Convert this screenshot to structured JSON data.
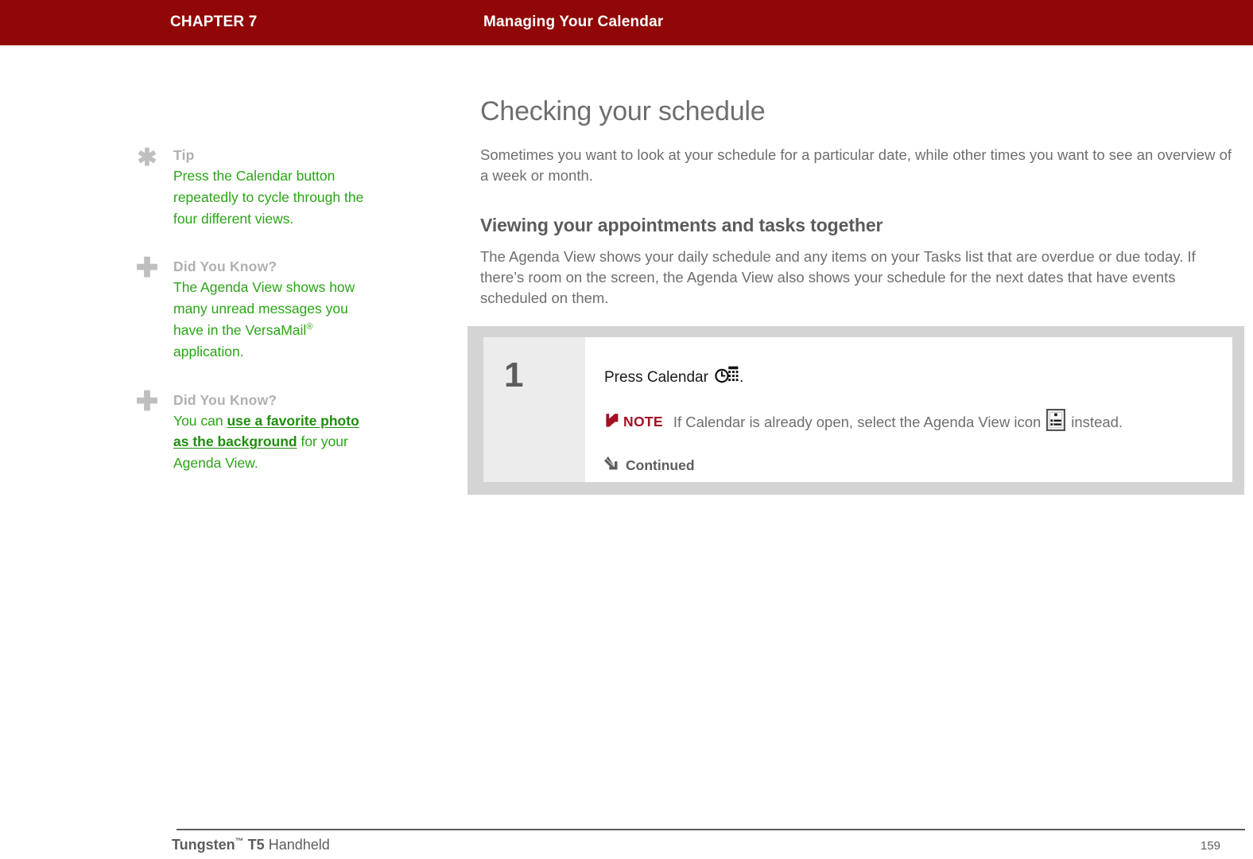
{
  "header": {
    "chapter": "CHAPTER 7",
    "title": "Managing Your Calendar",
    "bar_color": "#910606"
  },
  "sidebar": {
    "items": [
      {
        "icon": "asterisk-icon",
        "label": "Tip",
        "body": "Press the Calendar button repeatedly to cycle through the four different views."
      },
      {
        "icon": "plus-icon",
        "label": "Did You Know?",
        "body_before": "The Agenda View shows how many unread messages you have in the VersaMail",
        "superscript": "®",
        "body_after": " application."
      },
      {
        "icon": "plus-icon",
        "label": "Did You Know?",
        "body_before": "You can ",
        "link": "use a favorite photo as the background",
        "body_after": " for your Agenda View."
      }
    ],
    "label_color": "#b0b0b0",
    "body_color": "#2aa515"
  },
  "main": {
    "page_title": "Checking your schedule",
    "intro": "Sometimes you want to look at your schedule for a particular date, while other times you want to see an overview of a week or month.",
    "section_title": "Viewing your appointments and tasks together",
    "section_body": "The Agenda View shows your daily schedule and any items on your Tasks list that are overdue or due today. If there’s room on the screen, the Agenda View also shows your schedule for the next dates that have events scheduled on them."
  },
  "step_box": {
    "number": "1",
    "instruction": "Press Calendar",
    "instruction_end": ".",
    "calendar_icon": "calendar-icon",
    "note_label": "NOTE",
    "note_icon": "note-flag-icon",
    "note_text_before": "If Calendar is already open, select the Agenda View icon",
    "agenda_icon": "agenda-view-icon",
    "note_text_after": "instead.",
    "continued_label": "Continued",
    "continued_icon": "arrow-down-right-icon",
    "note_color": "#a41022",
    "frame_color": "#d4d4d4",
    "number_col_color": "#ececec"
  },
  "footer": {
    "product_bold": "Tungsten",
    "product_sup": "™",
    "product_model": "T5",
    "product_suffix": "Handheld",
    "page_number": "159"
  }
}
